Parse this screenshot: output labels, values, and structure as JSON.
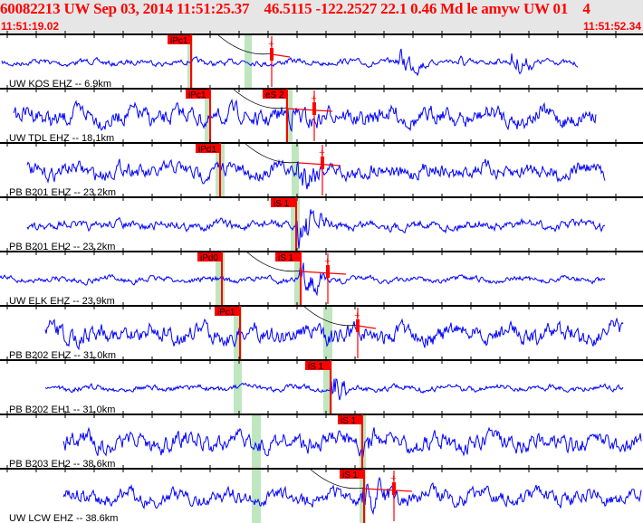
{
  "header": {
    "title": "60082213 UW Sep 03, 2014 11:51:25.37    46.5115 -122.2527 22.1 0.46 Md le amyw UW 01    4",
    "start_time": "11:51:19.02",
    "end_time": "11:51:52.34"
  },
  "chart_data": {
    "type": "line",
    "title": "Seismogram waveforms",
    "x_range": [
      "11:51:19.02",
      "11:51:52.34"
    ],
    "colors": {
      "trace": "#0000ff",
      "pick": "#ff0000",
      "window": "#bfe6bf"
    },
    "channels": [
      {
        "label": "UW KOS EHZ -- 6.9km",
        "picks": [
          "iPc1"
        ]
      },
      {
        "label": "UW TDL EHZ -- 18.1km",
        "picks": [
          "iPc1",
          "eS 2"
        ]
      },
      {
        "label": "PB B201 EHZ -- 23.2km",
        "picks": [
          "iPd1"
        ]
      },
      {
        "label": "PB B201 EH2 -- 23.2km",
        "picks": [
          "iS 1"
        ]
      },
      {
        "label": "UW ELK EHZ -- 23.9km",
        "picks": [
          "iPd0",
          "iS 1"
        ]
      },
      {
        "label": "PB B202 EHZ -- 31.0km",
        "picks": [
          "iPc1"
        ]
      },
      {
        "label": "PB B202 EH1 -- 31.0km",
        "picks": [
          "iS 1"
        ]
      },
      {
        "label": "PB B203 EH2 -- 38.6km",
        "picks": [
          "iS 1"
        ]
      },
      {
        "label": "UW LCW EHZ -- 38.6km",
        "picks": [
          "iS 1"
        ]
      }
    ]
  }
}
